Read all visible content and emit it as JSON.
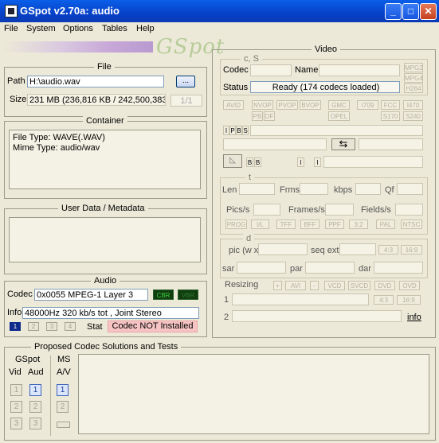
{
  "window": {
    "title": "GSpot v2.70a: audio"
  },
  "menu": [
    "File",
    "System",
    "Options",
    "Tables",
    "Help"
  ],
  "logo_text": "GSpot",
  "file": {
    "legend": "File",
    "path_label": "Path",
    "path_value": "H:\\audio.wav",
    "browse_label": "...",
    "size_label": "Size",
    "size_value": "231 MB (236,816 KB / 242,500,383",
    "page_indicator": "1/1"
  },
  "container": {
    "legend": "Container",
    "line1": "File Type: WAVE(.WAV)",
    "line2": "Mime Type: audio/wav"
  },
  "metadata": {
    "legend": "User Data / Metadata"
  },
  "audio": {
    "legend": "Audio",
    "codec_label": "Codec",
    "codec_value": "0x0055 MPEG-1 Layer 3",
    "cbr": "CBR",
    "vbr": "VBR",
    "info_label": "Info",
    "info_value": "48000Hz  320 kb/s tot , Joint Stereo",
    "streams": [
      "1",
      "2",
      "3",
      "4"
    ],
    "stat_label": "Stat",
    "stat_value": "Codec NOT Installed"
  },
  "video": {
    "legend": "Video",
    "codecs_legend": "c, S",
    "codec_label": "Codec",
    "name_label": "Name",
    "status_label": "Status",
    "status_value": "Ready (174 codecs loaded)",
    "side_tags": [
      "MPG2",
      "MPG4",
      "H264"
    ],
    "tags_row1": [
      "AVID",
      "NVOP",
      "PVOP",
      "BVOP",
      "GMC",
      "I709",
      "FCC",
      "I470"
    ],
    "tags_row2": [
      "PB",
      "DF",
      "OPEL",
      "S170",
      "S240"
    ],
    "frame_types": [
      "I",
      "P",
      "B",
      "S"
    ],
    "bb": [
      "B",
      "B"
    ],
    "ii": [
      "I",
      "I"
    ],
    "t_legend": "t",
    "len_label": "Len",
    "frms_label": "Frms",
    "kbps_label": "kbps",
    "qf_label": "Qf",
    "pics_label": "Pics/s",
    "frames_label": "Frames/s",
    "fields_label": "Fields/s",
    "flags": [
      "PROG",
      "I/L",
      "TFF",
      "BFF",
      "PPF",
      "3:2",
      "PAL",
      "NTSC"
    ],
    "d_legend": "d",
    "pic_label": "pic (w x",
    "seq_label": "seq ext",
    "ar_btns": [
      "4:3",
      "16:9"
    ],
    "sar_label": "sar",
    "par_label": "par",
    "dar_label": "dar",
    "resizing_label": "Resizing",
    "resize_btns": [
      "+",
      "AVI",
      "-",
      "VCD",
      "SVCD",
      "DVD",
      "OVD"
    ],
    "row1": "1",
    "row2": "2",
    "info_link": "info"
  },
  "proposed": {
    "legend": "Proposed Codec Solutions and Tests",
    "gspot_label": "GSpot",
    "vid_label": "Vid",
    "aud_label": "Aud",
    "ms_label": "MS",
    "av_label": "A/V",
    "nums": [
      "1",
      "2",
      "3"
    ]
  }
}
